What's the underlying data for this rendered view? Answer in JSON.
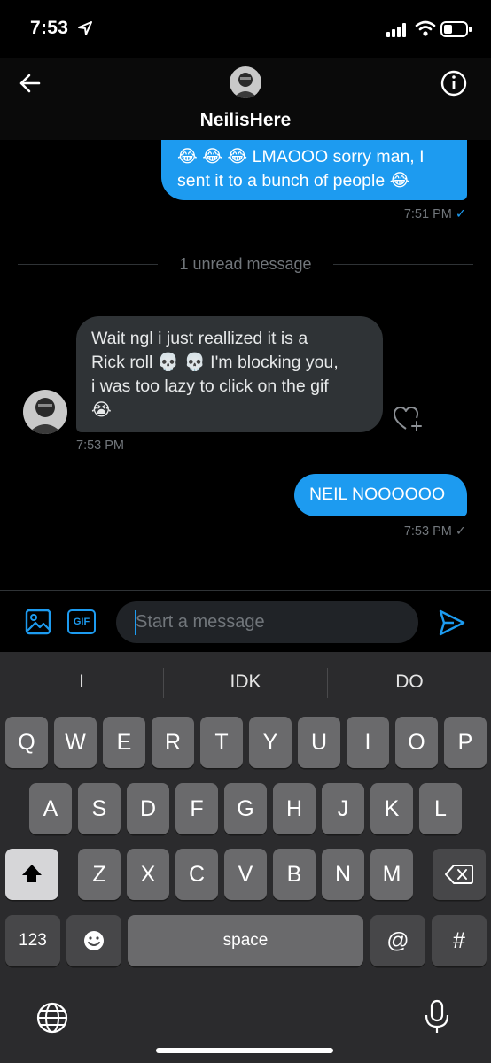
{
  "status_bar": {
    "time": "7:53"
  },
  "header": {
    "contact_name": "NeilisHere"
  },
  "messages": [
    {
      "direction": "outgoing",
      "lines": [
        "😂 😂 😂 LMAOOO sorry man, I",
        "sent it to a bunch of people 😂"
      ],
      "time": "7:51 PM",
      "status": "✓"
    },
    {
      "direction": "incoming",
      "lines": [
        "Wait ngl i just reallized it is a",
        "Rick roll 💀 💀 I'm blocking you,",
        "i was too lazy to click on the gif",
        "😭"
      ],
      "time": "7:53 PM"
    },
    {
      "direction": "outgoing",
      "lines": [
        "NEIL NOOOOOO"
      ],
      "time": "7:53 PM",
      "status": "✓"
    }
  ],
  "unread_divider": "1 unread message",
  "composer": {
    "placeholder": "Start a message",
    "gif_label": "GIF"
  },
  "keyboard": {
    "suggestions": [
      "I",
      "IDK",
      "DO"
    ],
    "row1": [
      "Q",
      "W",
      "E",
      "R",
      "T",
      "Y",
      "U",
      "I",
      "O",
      "P"
    ],
    "row2": [
      "A",
      "S",
      "D",
      "F",
      "G",
      "H",
      "J",
      "K",
      "L"
    ],
    "row3": [
      "Z",
      "X",
      "C",
      "V",
      "B",
      "N",
      "M"
    ],
    "numbers_key": "123",
    "space_key": "space",
    "at_key": "@",
    "hash_key": "#"
  },
  "colors": {
    "accent": "#1d9bf0",
    "incoming_bubble": "#2f3336",
    "background": "#000000"
  },
  "icons": [
    "location-arrow-icon",
    "signal-icon",
    "wifi-icon",
    "battery-icon",
    "back-arrow-icon",
    "info-icon",
    "add-reaction-icon",
    "image-icon",
    "gif-icon",
    "send-icon",
    "shift-icon",
    "backspace-icon",
    "emoji-icon",
    "globe-icon",
    "microphone-icon"
  ]
}
